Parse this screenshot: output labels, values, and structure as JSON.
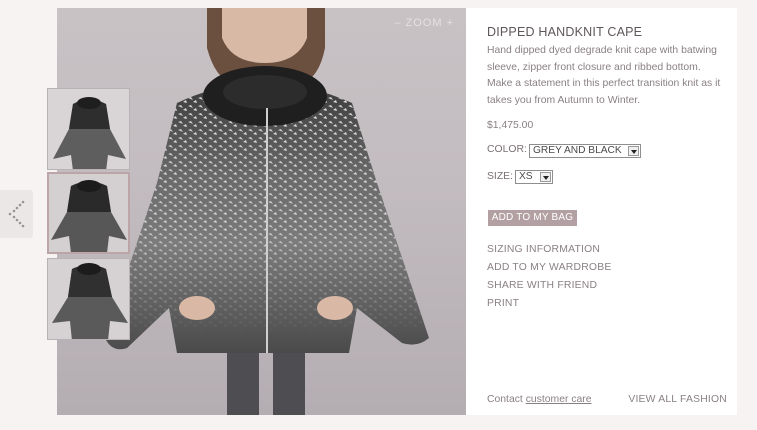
{
  "product": {
    "title": "DIPPED HANDKNIT CAPE",
    "description": "Hand dipped dyed degrade knit cape with batwing sleeve, zipper front closure and ribbed bottom. Make a statement in this perfect transition knit as it takes you from Autumn to Winter.",
    "price": "$1,475.00"
  },
  "options": {
    "color_label": "COLOR:",
    "color_value": "GREY AND BLACK",
    "size_label": "SIZE:",
    "size_value": "XS"
  },
  "actions": {
    "add_to_bag": "ADD TO MY BAG",
    "links": [
      "SIZING INFORMATION",
      "ADD TO MY WARDROBE",
      "SHARE WITH FRIEND",
      "PRINT"
    ]
  },
  "viewer": {
    "zoom_label": "– ZOOM +"
  },
  "footer": {
    "contact_prefix": "Contact",
    "contact_link": "customer care",
    "view_all": "VIEW ALL FASHION"
  },
  "icons": {
    "share": "share-icon"
  },
  "colors": {
    "accent": "#b3a0a2",
    "panel_bg": "#ffffff",
    "page_bg": "#f7f3f3"
  }
}
